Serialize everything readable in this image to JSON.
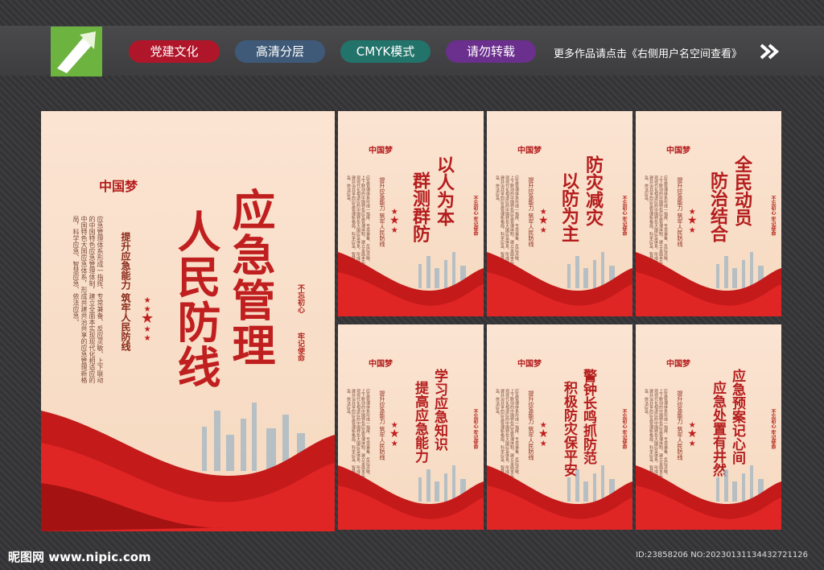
{
  "toolbar": {
    "tags": [
      "党建文化",
      "高清分层",
      "CMYK模式",
      "请勿转载"
    ],
    "notice": "更多作品请点击《右侧用户名空间查看》"
  },
  "main_panel": {
    "logo": "中国梦",
    "title_col1": "人民防线",
    "title_col2": "应急管理",
    "subtitle": "提升应急能力 筑牢人民防线",
    "body": "应急管理体系形成一指挥、专常兼备、反应灵敏、上下联动的中国特色应急管理体制，建立全面本实现现代化相适应的中国特色大国应急体系，形成共建共治共享的应急管理新格局，科学应急、智慧应急、依法应急。",
    "slogan1": "不忘初心",
    "slogan2": "牢记使命"
  },
  "posters": [
    {
      "col1": "群测群防",
      "col2": "以人为本"
    },
    {
      "col1": "以防为主",
      "col2": "防灾减灾"
    },
    {
      "col1": "防治结合",
      "col2": "全民动员"
    },
    {
      "col1": "提高应急能力",
      "col2": "学习应急知识"
    },
    {
      "col1": "积极防灾保平安",
      "col2": "警钟长鸣抓防范"
    },
    {
      "col1": "应急处置有井然",
      "col2": "应急预案记心间"
    }
  ],
  "poster_sub": "提升应急能力 筑牢人民防线",
  "poster_slogan": "不忘初心 牢记使命",
  "footer": {
    "site": "昵图网 www.nipic.com",
    "id": "ID:23858206 NO:20230131134432721126"
  },
  "colors": {
    "accent": "#c01f1f",
    "pill1": "#b0162a",
    "pill2": "#3f5a78",
    "pill3": "#22736a",
    "pill4": "#6b2f8d"
  }
}
